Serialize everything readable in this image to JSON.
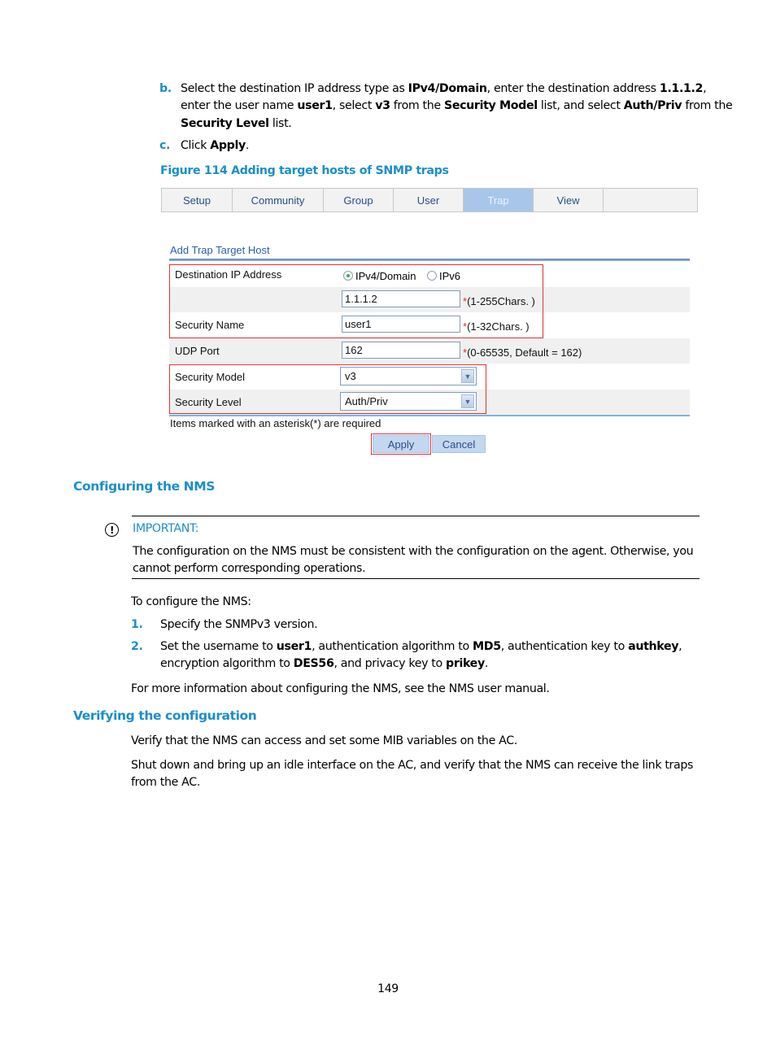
{
  "steps_ab": {
    "b": {
      "letter": "b.",
      "line1": [
        "Select the destination IP address type as ",
        "IPv4/Domain",
        ", enter the destination address ",
        "1.1.1.2",
        ","
      ],
      "line2": [
        "enter the user name ",
        "user1",
        ", select ",
        "v3",
        " from the ",
        "Security Model",
        " list, and select ",
        "Auth/Priv",
        " from the"
      ],
      "line3": [
        "Security Level",
        " list."
      ]
    },
    "c": {
      "letter": "c.",
      "text": "Click ",
      "bold": "Apply",
      "end": "."
    }
  },
  "figure": {
    "caption": "Figure 114 Adding target hosts of SNMP traps",
    "tabs": [
      {
        "label": "Setup",
        "active": false
      },
      {
        "label": "Community",
        "active": false
      },
      {
        "label": "Group",
        "active": false
      },
      {
        "label": "User",
        "active": false
      },
      {
        "label": "Trap",
        "active": true
      },
      {
        "label": "View",
        "active": false
      }
    ],
    "panel_title": "Add Trap Target Host",
    "form": {
      "dest_ip_label": "Destination IP Address",
      "ip_type_options": [
        "IPv4/Domain",
        "IPv6"
      ],
      "ip_type_selected": "IPv4/Domain",
      "dest_address_value": "1.1.1.2",
      "dest_address_hint": "(1-255Chars. )",
      "security_name_label": "Security Name",
      "security_name_value": "user1",
      "security_name_hint": "(1-32Chars. )",
      "udp_port_label": "UDP Port",
      "udp_port_value": "162",
      "udp_port_hint": "(0-65535, Default = 162)",
      "security_model_label": "Security Model",
      "security_model_value": "v3",
      "security_level_label": "Security Level",
      "security_level_value": "Auth/Priv",
      "required_note": "Items marked with an asterisk(*) are required",
      "asterisk": "*",
      "apply_label": "Apply",
      "cancel_label": "Cancel"
    },
    "colors": {
      "highlight": "#e03232",
      "active_tab": "#a8c6ea",
      "accent": "#1a8fc9"
    }
  },
  "configuring_nms": {
    "heading": "Configuring the NMS",
    "important_label": "IMPORTANT:",
    "important_line1": "The configuration on the NMS must be consistent with the configuration on the agent. Otherwise, you",
    "important_line2": "cannot perform corresponding operations.",
    "intro": "To configure the NMS:",
    "steps": [
      {
        "num": "1.",
        "text": "Specify the SNMPv3 version."
      },
      {
        "num": "2.",
        "line1": [
          "Set the username to ",
          "user1",
          ", authentication algorithm to ",
          "MD5",
          ", authentication key to ",
          "authkey",
          ","
        ],
        "line2": [
          "encryption algorithm to ",
          "DES56",
          ", and privacy key to ",
          "prikey",
          "."
        ]
      }
    ],
    "more_info": "For more information about configuring the NMS, see the NMS user manual."
  },
  "verifying": {
    "heading": "Verifying the configuration",
    "para1": "Verify that the NMS can access and set some MIB variables on the AC.",
    "para2_line1": "Shut down and bring up an idle interface on the AC, and verify that the NMS can receive the link traps",
    "para2_line2": "from the AC."
  },
  "page_number": "149"
}
